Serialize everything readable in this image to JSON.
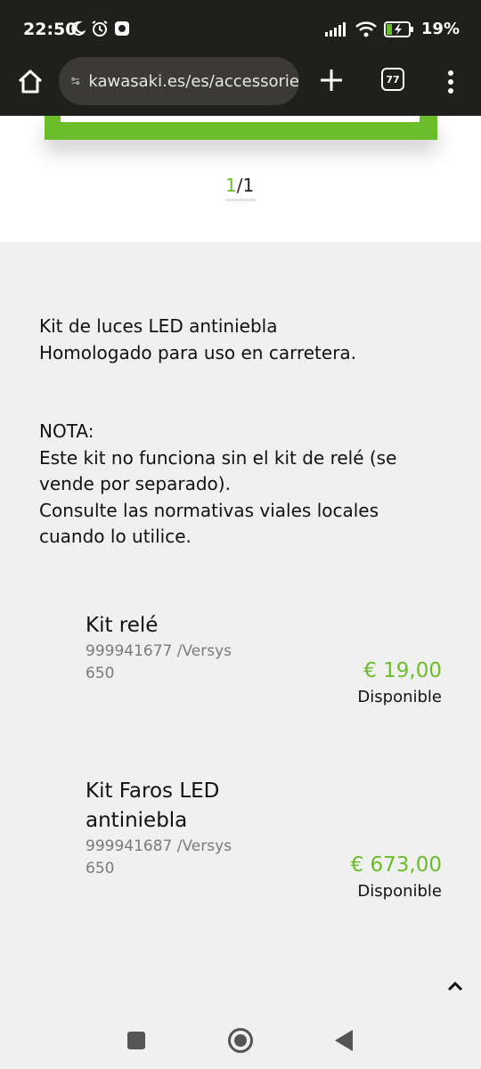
{
  "status_bar": {
    "time": "22:50",
    "battery": "19%",
    "icons_left": [
      "moon-icon",
      "alarm-icon",
      "record-icon"
    ],
    "icons_right": [
      "signal-icon",
      "wifi-icon",
      "battery-charging-icon"
    ]
  },
  "browser": {
    "url": "kawasaki.es/es/accessorie",
    "tab_count": "77",
    "icons": [
      "home-icon",
      "site-settings-icon",
      "new-tab-icon",
      "tabs-icon",
      "menu-icon"
    ]
  },
  "gallery": {
    "pager_current": "1",
    "pager_total": "/1"
  },
  "description": {
    "lines_1": [
      "Kit de luces LED antiniebla",
      "Homologado para uso en carretera."
    ],
    "lines_2": [
      "NOTA:",
      "Este kit no funciona sin el kit de relé (se vende por separado).",
      "Consulte las normativas viales locales cuando lo utilice."
    ]
  },
  "products": [
    {
      "name": "Kit relé",
      "ref": "999941677 /Versys 650",
      "price": "€ 19,00",
      "availability": "Disponible"
    },
    {
      "name": "Kit Faros LED antiniebla",
      "ref": "999941687 /Versys 650",
      "price": "€ 673,00",
      "availability": "Disponible"
    }
  ],
  "colors": {
    "accent": "#6cbd2a",
    "browser_bar": "#1f1f1c",
    "page_bg": "#f0f0f0"
  },
  "nav": {
    "icons": [
      "recents-icon",
      "home-nav-icon",
      "back-icon",
      "scroll-top-icon"
    ]
  }
}
